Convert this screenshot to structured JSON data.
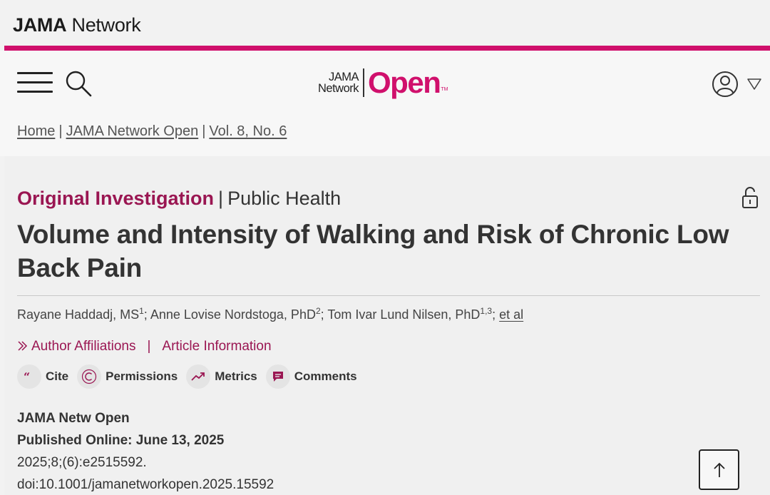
{
  "network_brand": {
    "bold": "JAMA",
    "rest": " Network"
  },
  "logo": {
    "line1": "JAMA",
    "line2": "Network",
    "open": "Open",
    "tm": "TM"
  },
  "breadcrumb": [
    {
      "label": "Home"
    },
    {
      "label": "JAMA Network Open"
    },
    {
      "label": "Vol. 8, No. 6"
    }
  ],
  "breadcrumb_sep": "|",
  "article": {
    "category": "Original Investigation",
    "category_sep": "|",
    "subcategory": "Public Health",
    "title": "Volume and Intensity of Walking and Risk of Chronic Low Back Pain",
    "authors": [
      {
        "name": "Rayane Haddadj, MS",
        "sup": "1"
      },
      {
        "name": "Anne Lovise Nordstoga, PhD",
        "sup": "2"
      },
      {
        "name": "Tom Ivar Lund Nilsen, PhD",
        "sup": "1,3"
      }
    ],
    "author_sep": "; ",
    "et_al": "et al",
    "links": {
      "affiliations": "Author Affiliations",
      "pipe": "|",
      "info": "Article Information"
    },
    "actions": [
      {
        "label": "Cite",
        "icon": "quote-icon"
      },
      {
        "label": "Permissions",
        "icon": "copyright-icon"
      },
      {
        "label": "Metrics",
        "icon": "trend-icon"
      },
      {
        "label": "Comments",
        "icon": "comment-icon"
      }
    ],
    "journal": "JAMA Netw Open",
    "published": "Published Online: June 13, 2025",
    "citation": "2025;8;(6):e2515592.",
    "doi": "doi:10.1001/jamanetworkopen.2025.15592"
  },
  "colors": {
    "accent": "#d0106c",
    "category": "#9a1652",
    "text": "#333333"
  }
}
